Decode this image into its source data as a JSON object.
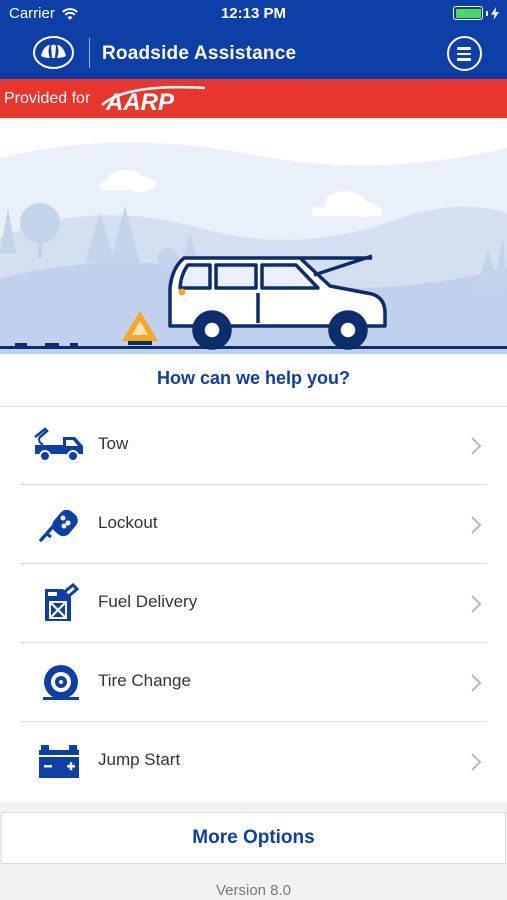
{
  "status_bar": {
    "carrier": "Carrier",
    "time": "12:13 PM"
  },
  "header": {
    "title": "Roadside Assistance",
    "logo_icon": "allstate-hands-logo-icon",
    "menu_icon": "hamburger-menu-icon"
  },
  "banner": {
    "provided_for": "Provided for",
    "partner_logo": "AARP"
  },
  "main": {
    "question": "How can we help you?",
    "services": [
      {
        "label": "Tow",
        "icon": "tow-truck-icon"
      },
      {
        "label": "Lockout",
        "icon": "car-key-icon"
      },
      {
        "label": "Fuel Delivery",
        "icon": "fuel-can-icon"
      },
      {
        "label": "Tire Change",
        "icon": "tire-icon"
      },
      {
        "label": "Jump Start",
        "icon": "car-battery-icon"
      }
    ],
    "more_options": "More Options",
    "version": "Version 8.0"
  },
  "colors": {
    "brand_blue": "#0d3fa6",
    "banner_red": "#e8362c",
    "battery_green": "#4cd964"
  }
}
